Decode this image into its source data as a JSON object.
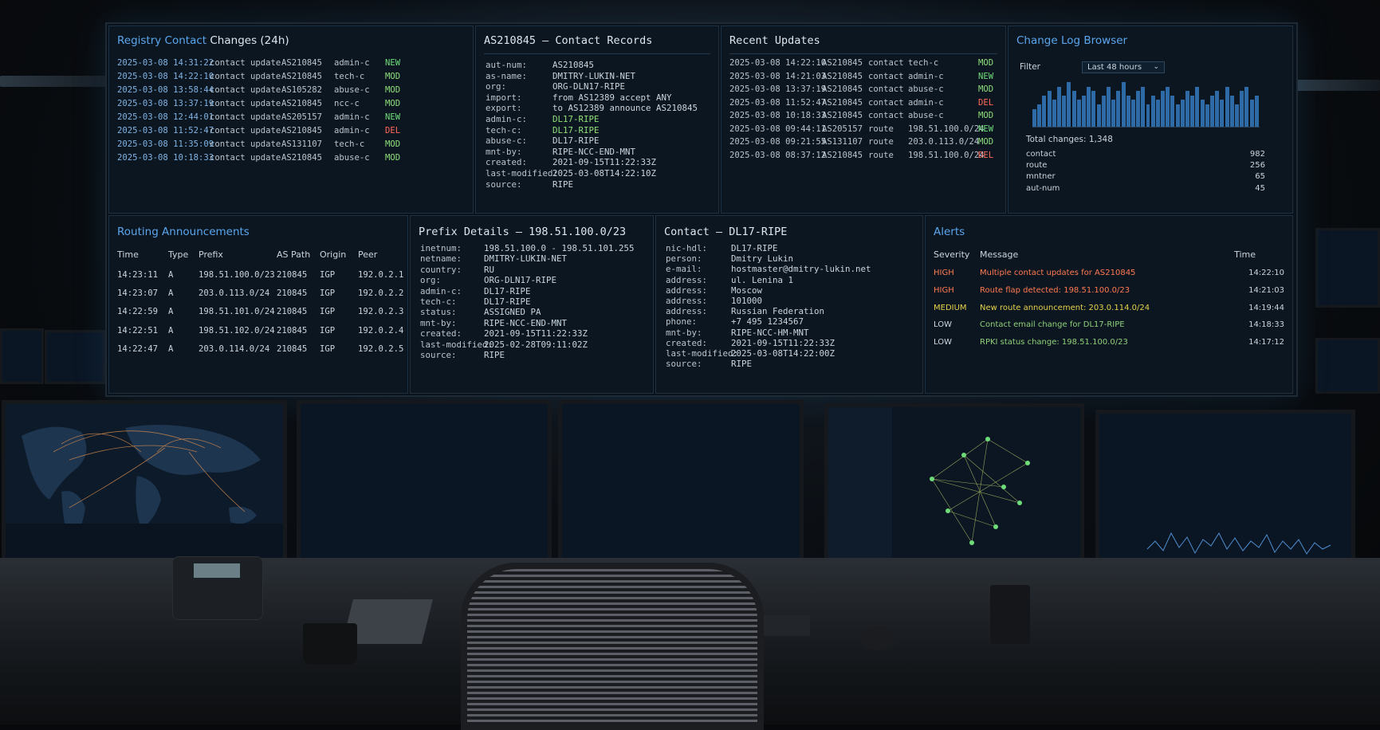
{
  "registry": {
    "title_a": "Registry Contact",
    "title_b": " Changes (24h)",
    "rows": [
      {
        "time": "2025-03-08 14:31:22",
        "action": "contact update",
        "asn": "AS210845",
        "handle": "admin-c",
        "status": "NEW"
      },
      {
        "time": "2025-03-08 14:22:10",
        "action": "contact update",
        "asn": "AS210845",
        "handle": "tech-c",
        "status": "MOD"
      },
      {
        "time": "2025-03-08 13:58:44",
        "action": "contact update",
        "asn": "AS105282",
        "handle": "abuse-c",
        "status": "MOD"
      },
      {
        "time": "2025-03-08 13:37:19",
        "action": "contact update",
        "asn": "AS210845",
        "handle": "ncc-c",
        "status": "MOD"
      },
      {
        "time": "2025-03-08 12:44:01",
        "action": "contact update",
        "asn": "AS205157",
        "handle": "admin-c",
        "status": "NEW"
      },
      {
        "time": "2025-03-08 11:52:47",
        "action": "contact update",
        "asn": "AS210845",
        "handle": "admin-c",
        "status": "DEL"
      },
      {
        "time": "2025-03-08 11:35:09",
        "action": "contact update",
        "asn": "AS131107",
        "handle": "tech-c",
        "status": "MOD"
      },
      {
        "time": "2025-03-08 10:18:33",
        "action": "contact update",
        "asn": "AS210845",
        "handle": "abuse-c",
        "status": "MOD"
      }
    ]
  },
  "contact_records": {
    "title": "AS210845 – Contact Records",
    "fields": [
      {
        "k": "aut-num:",
        "v": "AS210845",
        "c": ""
      },
      {
        "k": "as-name:",
        "v": "DMITRY-LUKIN-NET",
        "c": ""
      },
      {
        "k": "org:",
        "v": "ORG-DLN17-RIPE",
        "c": ""
      },
      {
        "k": "import:",
        "v": "from AS12389 accept ANY",
        "c": ""
      },
      {
        "k": "export:",
        "v": "to AS12389 announce AS210845",
        "c": ""
      },
      {
        "k": "admin-c:",
        "v": "DL17-RIPE",
        "c": "#8fe07a"
      },
      {
        "k": "tech-c:",
        "v": "DL17-RIPE",
        "c": "#8fe07a"
      },
      {
        "k": "abuse-c:",
        "v": "DL17-RIPE",
        "c": ""
      },
      {
        "k": "mnt-by:",
        "v": "RIPE-NCC-END-MNT",
        "c": ""
      },
      {
        "k": "created:",
        "v": "2021-09-15T11:22:33Z",
        "c": ""
      },
      {
        "k": "last-modified:",
        "v": "2025-03-08T14:22:10Z",
        "c": ""
      },
      {
        "k": "source:",
        "v": "RIPE",
        "c": ""
      }
    ]
  },
  "recent_updates": {
    "title": "Recent Updates",
    "rows": [
      {
        "time": "2025-03-08 14:22:10",
        "asn": "AS210845",
        "type": "contact",
        "obj": "tech-c",
        "status": "MOD"
      },
      {
        "time": "2025-03-08 14:21:03",
        "asn": "AS210845",
        "type": "contact",
        "obj": "admin-c",
        "status": "NEW"
      },
      {
        "time": "2025-03-08 13:37:19",
        "asn": "AS210845",
        "type": "contact",
        "obj": "abuse-c",
        "status": "MOD"
      },
      {
        "time": "2025-03-08 11:52:47",
        "asn": "AS210845",
        "type": "contact",
        "obj": "admin-c",
        "status": "DEL"
      },
      {
        "time": "2025-03-08 10:18:33",
        "asn": "AS210845",
        "type": "contact",
        "obj": "abuse-c",
        "status": "MOD"
      },
      {
        "time": "2025-03-08 09:44:11",
        "asn": "AS205157",
        "type": "route",
        "obj": "198.51.100.0/24",
        "status": "NEW"
      },
      {
        "time": "2025-03-08 09:21:55",
        "asn": "AS131107",
        "type": "route",
        "obj": "203.0.113.0/24",
        "status": "MOD"
      },
      {
        "time": "2025-03-08 08:37:12",
        "asn": "AS210845",
        "type": "route",
        "obj": "198.51.100.0/24",
        "status": "DEL"
      }
    ]
  },
  "changelog": {
    "title": "Change Log Browser",
    "filter_label": "Filter",
    "filter_value": "Last 48 hours",
    "bar_values": [
      4,
      5,
      7,
      8,
      6,
      9,
      7,
      10,
      8,
      6,
      7,
      9,
      8,
      5,
      7,
      9,
      6,
      8,
      10,
      7,
      6,
      8,
      9,
      5,
      7,
      6,
      8,
      9,
      7,
      5,
      6,
      8,
      7,
      9,
      6,
      5,
      7,
      8,
      6,
      9,
      7,
      5,
      8,
      9,
      6,
      7
    ],
    "total": "Total changes: 1,348",
    "breakdown": [
      {
        "label": "contact",
        "value": "982"
      },
      {
        "label": "route",
        "value": "256"
      },
      {
        "label": "mntner",
        "value": "65"
      },
      {
        "label": "aut-num",
        "value": "45"
      }
    ]
  },
  "routing": {
    "title": "Routing Announcements",
    "headers": [
      "Time",
      "Type",
      "Prefix",
      "AS Path",
      "Origin",
      "Peer"
    ],
    "rows": [
      [
        "14:23:11",
        "A",
        "198.51.100.0/23",
        "210845",
        "IGP",
        "192.0.2.1"
      ],
      [
        "14:23:07",
        "A",
        "203.0.113.0/24",
        "210845",
        "IGP",
        "192.0.2.2"
      ],
      [
        "14:22:59",
        "A",
        "198.51.101.0/24",
        "210845",
        "IGP",
        "192.0.2.3"
      ],
      [
        "14:22:51",
        "A",
        "198.51.102.0/24",
        "210845",
        "IGP",
        "192.0.2.4"
      ],
      [
        "14:22:47",
        "A",
        "203.0.114.0/24",
        "210845",
        "IGP",
        "192.0.2.5"
      ]
    ]
  },
  "prefix": {
    "title": "Prefix Details – 198.51.100.0/23",
    "fields": [
      {
        "k": "inetnum:",
        "v": "198.51.100.0 - 198.51.101.255"
      },
      {
        "k": "netname:",
        "v": "DMITRY-LUKIN-NET"
      },
      {
        "k": "country:",
        "v": "RU"
      },
      {
        "k": "org:",
        "v": "ORG-DLN17-RIPE"
      },
      {
        "k": "admin-c:",
        "v": "DL17-RIPE"
      },
      {
        "k": "tech-c:",
        "v": "DL17-RIPE"
      },
      {
        "k": "status:",
        "v": "ASSIGNED PA"
      },
      {
        "k": "mnt-by:",
        "v": "RIPE-NCC-END-MNT"
      },
      {
        "k": "created:",
        "v": "2021-09-15T11:22:33Z"
      },
      {
        "k": "last-modified:",
        "v": "2025-02-28T09:11:02Z"
      },
      {
        "k": "source:",
        "v": "RIPE"
      }
    ]
  },
  "contact": {
    "title": "Contact – DL17-RIPE",
    "fields": [
      {
        "k": "nic-hdl:",
        "v": "DL17-RIPE"
      },
      {
        "k": "person:",
        "v": "Dmitry Lukin"
      },
      {
        "k": "e-mail:",
        "v": "hostmaster@dmitry-lukin.net"
      },
      {
        "k": "address:",
        "v": "ul. Lenina 1"
      },
      {
        "k": "address:",
        "v": "Moscow"
      },
      {
        "k": "address:",
        "v": "101000"
      },
      {
        "k": "address:",
        "v": "Russian Federation"
      },
      {
        "k": "phone:",
        "v": "+7 495 1234567"
      },
      {
        "k": "mnt-by:",
        "v": "RIPE-NCC-HM-MNT"
      },
      {
        "k": "created:",
        "v": "2021-09-15T11:22:33Z"
      },
      {
        "k": "last-modified:",
        "v": "2025-03-08T14:22:00Z"
      },
      {
        "k": "source:",
        "v": "RIPE"
      }
    ]
  },
  "alerts": {
    "title": "Alerts",
    "headers": [
      "Severity",
      "Message",
      "Time"
    ],
    "rows": [
      {
        "sev": "HIGH",
        "msg": "Multiple contact updates for AS210845",
        "time": "14:22:10",
        "level": "high"
      },
      {
        "sev": "HIGH",
        "msg": "Route flap detected: 198.51.100.0/23",
        "time": "14:21:03",
        "level": "high"
      },
      {
        "sev": "MEDIUM",
        "msg": "New route announcement: 203.0.114.0/24",
        "time": "14:19:44",
        "level": "med"
      },
      {
        "sev": "LOW",
        "msg": "Contact email change for DL17-RIPE",
        "time": "14:18:33",
        "level": "low"
      },
      {
        "sev": "LOW",
        "msg": "RPKI status change: 198.51.100.0/23",
        "time": "14:17:12",
        "level": "low"
      }
    ]
  }
}
